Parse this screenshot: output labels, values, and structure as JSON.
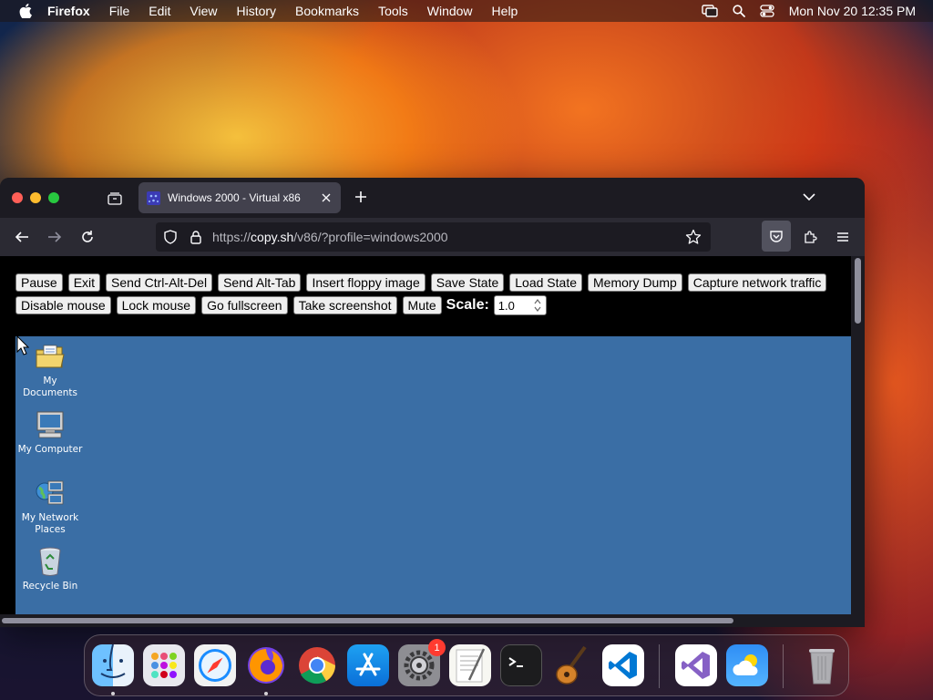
{
  "menubar": {
    "app_name": "Firefox",
    "items": [
      "File",
      "Edit",
      "View",
      "History",
      "Bookmarks",
      "Tools",
      "Window",
      "Help"
    ],
    "clock": "Mon Nov 20  12:35 PM"
  },
  "browser": {
    "tab_title": "Windows 2000 - Virtual x86",
    "url_prefix": "https://",
    "url_host": "copy.sh",
    "url_path": "/v86/?profile=windows2000"
  },
  "controls": {
    "row1": [
      "Pause",
      "Exit",
      "Send Ctrl-Alt-Del",
      "Send Alt-Tab",
      "Insert floppy image",
      "Save State",
      "Load State",
      "Memory Dump",
      "Capture network traffic"
    ],
    "row2": [
      "Disable mouse",
      "Lock mouse",
      "Go fullscreen",
      "Take screenshot",
      "Mute"
    ],
    "scale_label": "Scale:",
    "scale_value": "1.0"
  },
  "desktop": {
    "icons": [
      {
        "label": "My Documents",
        "icon": "folder-documents-icon"
      },
      {
        "label": "My Computer",
        "icon": "computer-icon"
      },
      {
        "label": "My Network Places",
        "icon": "network-places-icon"
      },
      {
        "label": "Recycle Bin",
        "icon": "recycle-bin-icon"
      }
    ]
  },
  "dock": {
    "apps": [
      "Finder",
      "Launchpad",
      "Safari",
      "Firefox",
      "Chrome",
      "App Store",
      "System Settings",
      "TextEdit",
      "Terminal",
      "GarageBand",
      "Visual Studio Code",
      "Visual Studio",
      "Weather",
      "Trash"
    ],
    "settings_badge": "1"
  }
}
